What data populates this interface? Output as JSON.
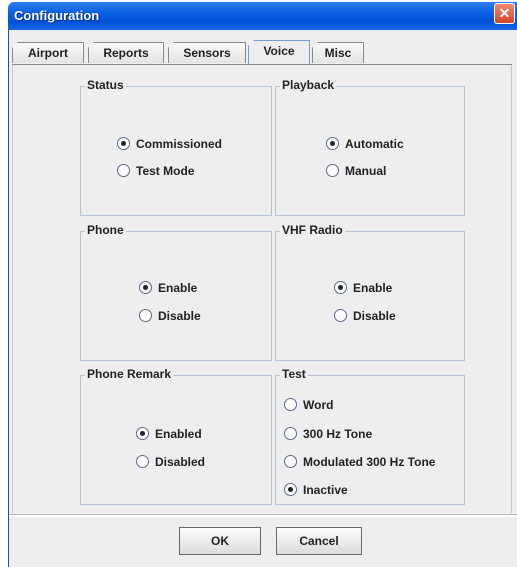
{
  "window": {
    "title": "Configuration",
    "close_icon": "close-icon"
  },
  "tabs": [
    {
      "label": "Airport",
      "active": false
    },
    {
      "label": "Reports",
      "active": false
    },
    {
      "label": "Sensors",
      "active": false
    },
    {
      "label": "Voice",
      "active": true
    },
    {
      "label": "Misc",
      "active": false
    }
  ],
  "groups": {
    "status": {
      "title": "Status",
      "options": [
        {
          "label": "Commissioned",
          "selected": true
        },
        {
          "label": "Test Mode",
          "selected": false
        }
      ]
    },
    "playback": {
      "title": "Playback",
      "options": [
        {
          "label": "Automatic",
          "selected": true
        },
        {
          "label": "Manual",
          "selected": false
        }
      ]
    },
    "phone": {
      "title": "Phone",
      "options": [
        {
          "label": "Enable",
          "selected": true
        },
        {
          "label": "Disable",
          "selected": false
        }
      ]
    },
    "vhf": {
      "title": "VHF Radio",
      "options": [
        {
          "label": "Enable",
          "selected": true
        },
        {
          "label": "Disable",
          "selected": false
        }
      ]
    },
    "phone_remark": {
      "title": "Phone Remark",
      "options": [
        {
          "label": "Enabled",
          "selected": true
        },
        {
          "label": "Disabled",
          "selected": false
        }
      ]
    },
    "test": {
      "title": "Test",
      "options": [
        {
          "label": "Word",
          "selected": false
        },
        {
          "label": "300 Hz Tone",
          "selected": false
        },
        {
          "label": "Modulated 300 Hz Tone",
          "selected": false
        },
        {
          "label": "Inactive",
          "selected": true
        }
      ]
    }
  },
  "buttons": {
    "ok": "OK",
    "cancel": "Cancel"
  }
}
